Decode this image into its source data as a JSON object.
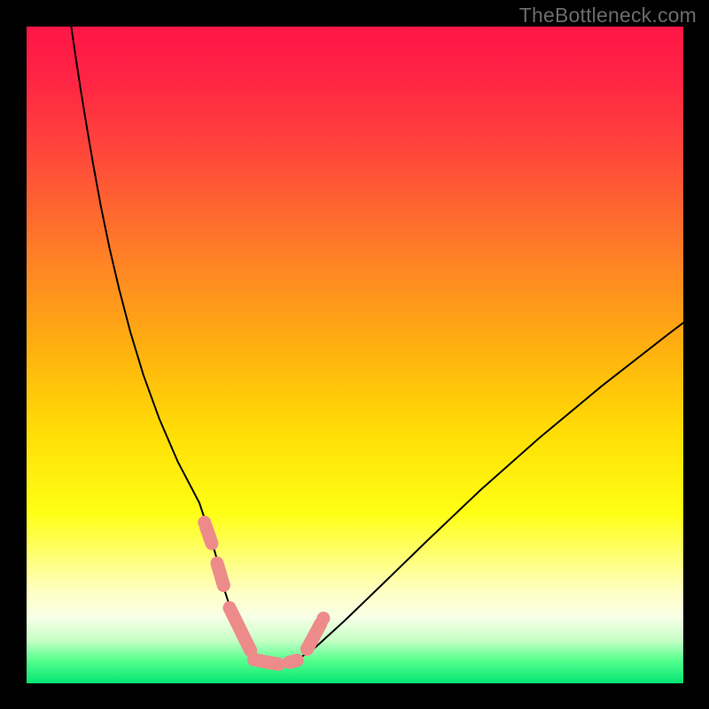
{
  "attribution": "TheBottleneck.com",
  "chart_data": {
    "type": "line",
    "title": "",
    "xlabel": "",
    "ylabel": "",
    "x_range": [
      0,
      100
    ],
    "y_range": [
      0,
      100
    ],
    "background_gradient": {
      "stops": [
        {
          "offset": 0.0,
          "color": "#ff1647"
        },
        {
          "offset": 0.08,
          "color": "#ff2444"
        },
        {
          "offset": 0.2,
          "color": "#ff4a3a"
        },
        {
          "offset": 0.35,
          "color": "#ff8026"
        },
        {
          "offset": 0.5,
          "color": "#ffb40e"
        },
        {
          "offset": 0.62,
          "color": "#ffde06"
        },
        {
          "offset": 0.74,
          "color": "#ffff14"
        },
        {
          "offset": 0.8,
          "color": "#ffff6a"
        },
        {
          "offset": 0.86,
          "color": "#ffffc4"
        },
        {
          "offset": 0.9,
          "color": "#f7ffe6"
        },
        {
          "offset": 0.935,
          "color": "#c6ffc6"
        },
        {
          "offset": 0.965,
          "color": "#56ff8e"
        },
        {
          "offset": 1.0,
          "color": "#04e572"
        }
      ]
    },
    "series": [
      {
        "name": "bottleneck-curve",
        "color": "#000000",
        "width": 2,
        "x": [
          6.8,
          7.5,
          8.3,
          9.2,
          10.2,
          11.3,
          12.6,
          14.1,
          15.8,
          17.8,
          20.2,
          23.0,
          26.3,
          27.8,
          29.1,
          30.2,
          31.5,
          33.3,
          35.9,
          37.5,
          38.8,
          40.8,
          44.0,
          48.5,
          54.3,
          61.3,
          69.2,
          78.0,
          87.5,
          97.5,
          100.0
        ],
        "y": [
          100,
          95.2,
          90.0,
          84.5,
          78.7,
          72.7,
          66.4,
          60.0,
          53.5,
          46.9,
          40.3,
          33.8,
          27.5,
          23.0,
          18.5,
          14.0,
          10.0,
          6.3,
          3.4,
          2.9,
          2.9,
          3.3,
          5.5,
          9.6,
          15.2,
          22.0,
          29.5,
          37.3,
          45.2,
          53.0,
          54.9
        ]
      }
    ],
    "markers": {
      "name": "highlight-segments",
      "color": "#ed8b8b",
      "stroke_width": 15,
      "segments": [
        {
          "x1": 27.3,
          "y1": 23.9,
          "x2": 28.2,
          "y2": 21.3
        },
        {
          "x1": 29.0,
          "y1": 18.3,
          "x2": 30.0,
          "y2": 14.9
        },
        {
          "x1": 30.9,
          "y1": 11.5,
          "x2": 34.1,
          "y2": 5.0
        },
        {
          "x1": 34.6,
          "y1": 3.6,
          "x2": 38.4,
          "y2": 2.9
        },
        {
          "x1": 40.0,
          "y1": 3.2,
          "x2": 41.2,
          "y2": 3.5
        },
        {
          "x1": 42.7,
          "y1": 5.2,
          "x2": 44.8,
          "y2": 9.1
        }
      ],
      "end_dots": [
        {
          "x": 27.1,
          "y": 24.5
        },
        {
          "x": 45.2,
          "y": 9.9
        }
      ]
    }
  }
}
